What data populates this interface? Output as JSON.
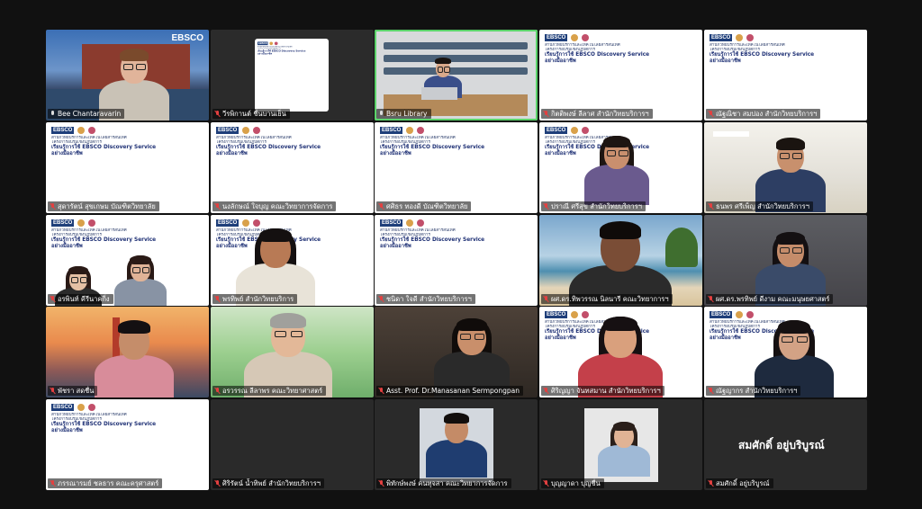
{
  "meeting": {
    "participants": [
      {
        "name": "Bee Chantaravarin",
        "muted": false
      },
      {
        "name": "วีรพิกานต์ ชื่นบานเย็น",
        "muted": true
      },
      {
        "name": "Bsru Library",
        "muted": false
      },
      {
        "name": "กิตติพงษ์ ลีลาศ สำนักวิทยบริการฯ",
        "muted": true
      },
      {
        "name": "ณัฐณิชา สมปอง สำนักวิทยบริการฯ",
        "muted": true
      },
      {
        "name": "สุดารัตน์ สุขเกษม บัณฑิตวิทยาลัย",
        "muted": true
      },
      {
        "name": "นงลักษณ์ ใจบุญ คณะวิทยาการจัดการ",
        "muted": true
      },
      {
        "name": "ศศิธร ทองดี บัณฑิตวิทยาลัย",
        "muted": true
      },
      {
        "name": "ปราณี ศรีสุข สำนักวิทยบริการฯ",
        "muted": true
      },
      {
        "name": "ธนพร ศรีเพ็ญ สำนักวิทยบริการฯ",
        "muted": true
      },
      {
        "name": "อรพินท์ คีรีนาคกิ่ง",
        "muted": true
      },
      {
        "name": "พรทิพย์ สำนักวิทยบริการ",
        "muted": true
      },
      {
        "name": "ชนิดา ใจดี สำนักวิทยบริการฯ",
        "muted": true
      },
      {
        "name": "ผศ.ดร.ทิพวรรณ นิลนารี คณะวิทยาการฯ",
        "muted": true
      },
      {
        "name": "ผศ.ดร.พรทิพย์ ดีงาม คณะมนุษยศาสตร์",
        "muted": true
      },
      {
        "name": "พัชรา สดชื่น",
        "muted": true
      },
      {
        "name": "อรวรรณ ลีลาพร คณะวิทยาศาสตร์",
        "muted": true
      },
      {
        "name": "Asst. Prof. Dr.Manasanan Sermpongpan",
        "muted": true
      },
      {
        "name": "ศิริญญา จันทสมาน สำนักวิทยบริการฯ",
        "muted": true
      },
      {
        "name": "ณัฐญากร สำนักวิทยบริการฯ",
        "muted": true
      },
      {
        "name": "ภรรณารมย์ ชลธาร คณะครุศาสตร์",
        "muted": true
      },
      {
        "name": "ศิริรัตน์ น้ำทิพย์ สำนักวิทยบริการฯ",
        "muted": true
      },
      {
        "name": "พิทักษ์พงษ์ คนทุจสา คณะวิทยาการจัดการ",
        "muted": true
      },
      {
        "name": "บุญญาดา บุญชื่น",
        "muted": true
      },
      {
        "name": "สมศักดิ์ อยู่บริบูรณ์",
        "muted": true
      }
    ],
    "placeholder_big_name": "สมศักดิ์ อยู่บริบูรณ์"
  },
  "slide": {
    "brand": "EBSCO",
    "line1": "สำนักวิทยบริการและเทคโนโลยีสารสนเทศ",
    "line2": "โครงการอบรมเชิงปฏิบัติการ",
    "line3": "เรียนรู้การใช้ EBSCO Discovery Service",
    "line4": "อย่างมืออาชีพ"
  },
  "video_brand": "EBSCO",
  "colors": {
    "speaker_border": "#5bd36a",
    "muted_mic": "#e34040",
    "background": "#111111"
  }
}
